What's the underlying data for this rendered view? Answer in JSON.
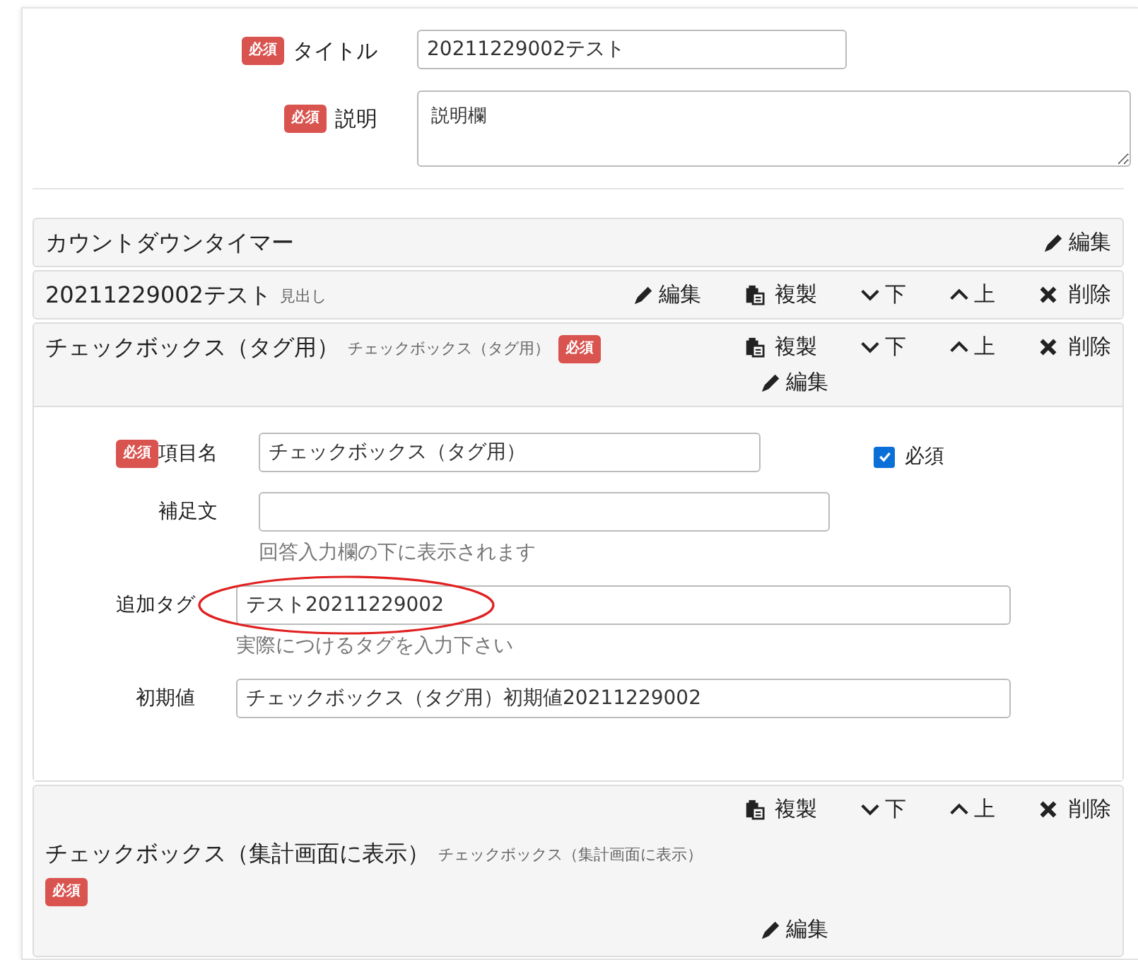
{
  "form": {
    "fields": [
      {
        "kind": "input",
        "required_badge": "必須",
        "label": "タイトル",
        "value": "20211229002テスト"
      },
      {
        "kind": "textarea",
        "required_badge": "必須",
        "label": "説明",
        "value": "説明欄"
      }
    ]
  },
  "items": [
    {
      "kind": "row",
      "title": "カウントダウンタイマー",
      "actions": [
        {
          "kind": "edit",
          "label": "編集"
        }
      ]
    },
    {
      "kind": "row",
      "title": "20211229002テスト",
      "type_label": "見出し",
      "actions": [
        {
          "kind": "edit",
          "label": "編集"
        },
        {
          "kind": "copy",
          "label": "複製"
        },
        {
          "kind": "down",
          "label": "下"
        },
        {
          "kind": "up",
          "label": "上"
        },
        {
          "kind": "delete",
          "label": "削除"
        }
      ]
    },
    {
      "kind": "row",
      "title": "チェックボックス（タグ用）",
      "type_label": "チェックボックス（タグ用）",
      "required_badge": "必須",
      "actions": [
        {
          "kind": "copy",
          "label": "複製"
        },
        {
          "kind": "down",
          "label": "下"
        },
        {
          "kind": "up",
          "label": "上"
        },
        {
          "kind": "delete",
          "label": "削除"
        }
      ],
      "actions_below": [
        {
          "kind": "edit",
          "label": "編集"
        }
      ],
      "editor": {
        "fields": [
          {
            "kind": "short",
            "required_badge": "必須",
            "label": "項目名",
            "value": "チェックボックス（タグ用）",
            "checkbox": {
              "label": "必須",
              "checked": true
            }
          },
          {
            "kind": "short",
            "label": "補足文",
            "help": "回答入力欄の下に表示されます"
          },
          {
            "kind": "long",
            "label": "追加タグ",
            "value": "テスト20211229002",
            "help": "実際につけるタグを入力下さい",
            "circled": true
          },
          {
            "kind": "long",
            "label": "初期値",
            "value": "チェックボックス（タグ用）初期値20211229002"
          }
        ]
      }
    },
    {
      "kind": "stacked",
      "title": "チェックボックス（集計画面に表示）",
      "type_label": "チェックボックス（集計画面に表示）",
      "required_badge": "必須",
      "actions": [
        {
          "kind": "copy",
          "label": "複製"
        },
        {
          "kind": "down",
          "label": "下"
        },
        {
          "kind": "up",
          "label": "上"
        },
        {
          "kind": "delete",
          "label": "削除"
        }
      ],
      "actions_below": [
        {
          "kind": "edit",
          "label": "編集"
        }
      ]
    }
  ]
}
